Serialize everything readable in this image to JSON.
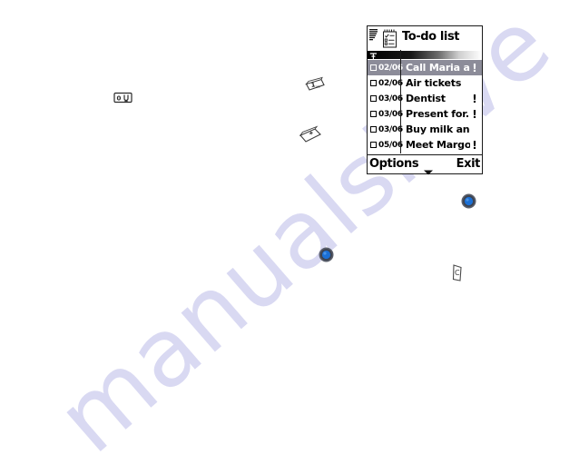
{
  "watermark": {
    "text": "manualshive"
  },
  "phone_screen": {
    "title": "To-do list",
    "icons": {
      "signal": "signal-bars-icon",
      "app": "notepad-checklist-icon",
      "antenna": "antenna-icon"
    },
    "rows": [
      {
        "date": "02/06",
        "title": "Call Maria a..",
        "priority": "!",
        "selected": true
      },
      {
        "date": "02/06",
        "title": "Air tickets",
        "priority": "",
        "selected": false
      },
      {
        "date": "03/06",
        "title": "Dentist",
        "priority": "!",
        "selected": false
      },
      {
        "date": "03/06",
        "title": "Present for..",
        "priority": "!",
        "selected": false
      },
      {
        "date": "03/06",
        "title": "Buy milk and j..",
        "priority": "",
        "selected": false
      },
      {
        "date": "05/06",
        "title": "Meet Margo..",
        "priority": "!",
        "selected": false
      }
    ],
    "softkeys": {
      "left_label": "Options",
      "right_label": "Exit",
      "center_icon": "chevron-down-icon"
    },
    "colors": {
      "selection_bg": "#8c8c99",
      "selection_text": "#ffffff",
      "border": "#1a1a1a",
      "joystick_blue": "#1b6fd4",
      "watermark": "#d9d9f2"
    }
  },
  "key_glyphs": [
    {
      "name": "key-1-icon",
      "label": "1",
      "sub": "ao"
    },
    {
      "name": "key-0-icon",
      "label": "0",
      "sub": ""
    },
    {
      "name": "key-star-icon",
      "label": "*",
      "sub": ""
    },
    {
      "name": "key-clear-icon",
      "label": "C",
      "sub": ""
    },
    {
      "name": "joystick-select-icon",
      "label": "",
      "sub": ""
    },
    {
      "name": "joystick-select-icon",
      "label": "",
      "sub": ""
    }
  ]
}
